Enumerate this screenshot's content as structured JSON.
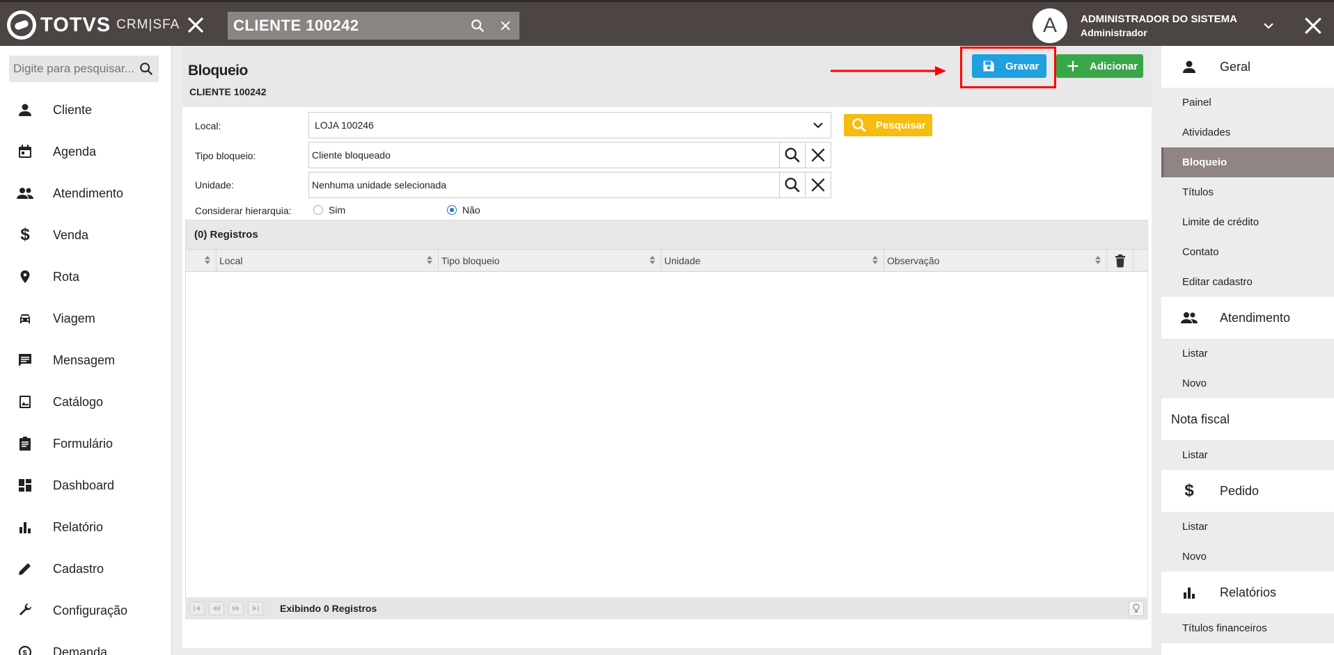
{
  "topbar": {
    "brand": "TOTVS",
    "brand_sub": "CRM|SFA",
    "search_value": "CLIENTE 100242",
    "avatar_letter": "A",
    "user_name": "ADMINISTRADOR DO SISTEMA",
    "user_role": "Administrador"
  },
  "leftnav": {
    "search_placeholder": "Digite para pesquisar...",
    "items": [
      {
        "label": "Cliente",
        "icon": "person-icon"
      },
      {
        "label": "Agenda",
        "icon": "calendar-icon"
      },
      {
        "label": "Atendimento",
        "icon": "people-icon"
      },
      {
        "label": "Venda",
        "icon": "dollar-icon"
      },
      {
        "label": "Rota",
        "icon": "location-pin-icon"
      },
      {
        "label": "Viagem",
        "icon": "car-icon"
      },
      {
        "label": "Mensagem",
        "icon": "message-icon"
      },
      {
        "label": "Catálogo",
        "icon": "image-icon"
      },
      {
        "label": "Formulário",
        "icon": "clipboard-icon"
      },
      {
        "label": "Dashboard",
        "icon": "dashboard-icon"
      },
      {
        "label": "Relatório",
        "icon": "bar-chart-icon"
      },
      {
        "label": "Cadastro",
        "icon": "pencil-icon"
      },
      {
        "label": "Configuração",
        "icon": "wrench-icon"
      },
      {
        "label": "Demanda",
        "icon": "demand-icon"
      }
    ]
  },
  "main": {
    "title": "Bloqueio",
    "subtitle": "CLIENTE 100242",
    "gravar_label": "Gravar",
    "adicionar_label": "Adicionar",
    "form": {
      "local_label": "Local:",
      "local_value": "LOJA 100246",
      "tipo_label": "Tipo bloqueio:",
      "tipo_value": "Cliente bloqueado",
      "unidade_label": "Unidade:",
      "unidade_value": "Nenhuma unidade selecionada",
      "hierarquia_label": "Considerar hierarquia:",
      "opt_sim": "Sim",
      "opt_nao": "Não",
      "hierarquia_selected": "Não",
      "pesquisar_label": "Pesquisar"
    },
    "grid": {
      "header": "(0) Registros",
      "columns": [
        "Local",
        "Tipo bloqueio",
        "Unidade",
        "Observação"
      ],
      "rows": [],
      "footer": "Exibindo 0 Registros"
    }
  },
  "rightnav": {
    "sections": [
      {
        "label": "Geral",
        "icon": "person-icon",
        "items": [
          "Painel",
          "Atividades",
          "Bloqueio",
          "Títulos",
          "Limite de crédito",
          "Contato",
          "Editar cadastro"
        ]
      },
      {
        "label": "Atendimento",
        "icon": "people-icon",
        "items": [
          "Listar",
          "Novo"
        ]
      },
      {
        "label": "Nota fiscal",
        "icon": "",
        "items": [
          "Listar"
        ]
      },
      {
        "label": "Pedido",
        "icon": "dollar-icon",
        "items": [
          "Listar",
          "Novo"
        ]
      },
      {
        "label": "Relatórios",
        "icon": "bar-chart-icon",
        "items": [
          "Títulos financeiros"
        ]
      }
    ],
    "active_item": "Bloqueio"
  },
  "colors": {
    "topbar": "#4d4544",
    "gravar": "#1fa0e0",
    "adicionar": "#3aa64a",
    "pesquisar": "#f6bc10",
    "highlight": "#ff0000"
  }
}
